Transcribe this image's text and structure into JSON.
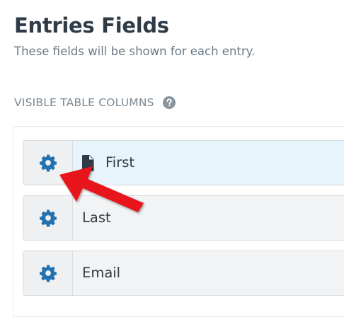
{
  "header": {
    "title": "Entries Fields",
    "subtitle": "These fields will be shown for each entry."
  },
  "section": {
    "heading": "VISIBLE TABLE COLUMNS",
    "help_icon": "question-circle-icon"
  },
  "fields": [
    {
      "label": "First",
      "settings_icon": "gear-icon",
      "type_icon": "document-icon",
      "active": true
    },
    {
      "label": "Last",
      "settings_icon": "gear-icon"
    },
    {
      "label": "Email",
      "settings_icon": "gear-icon"
    }
  ],
  "colors": {
    "accent": "#2271b1",
    "active_row": "#e7f4fb",
    "annotation_arrow": "#e8141b"
  }
}
